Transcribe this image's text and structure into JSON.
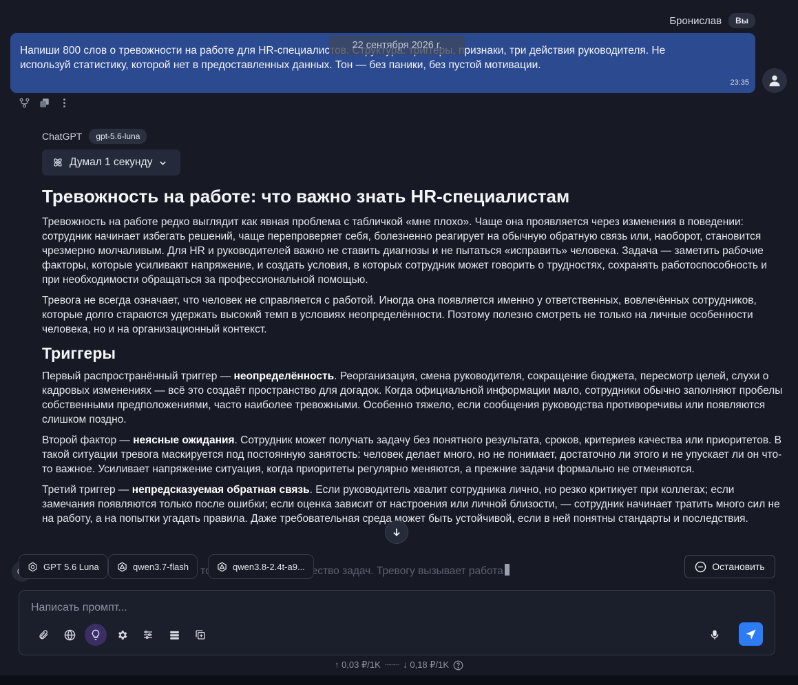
{
  "user": {
    "name": "Бронислав",
    "badge": "Вы",
    "message": "Напиши 800 слов о тревожности на работе для HR-специалистов. Структура: триггеры, признаки, три действия руководителя. Не используй статистику, которой нет в предоставленных данных. Тон — без паники, без пустой мотивации.",
    "time": "23:35"
  },
  "date_separator": "22 сентября 2026 г.",
  "message_actions": [
    "branch-icon",
    "copy-icon",
    "more-icon"
  ],
  "assistant": {
    "name": "ChatGPT",
    "model": "gpt-5.6-luna",
    "thinking_label": "Думал 1 секунду"
  },
  "answer": {
    "title": "Тревожность на работе: что важно знать HR-специалистам",
    "intro_1": "Тревожность на работе редко выглядит как явная проблема с табличкой «мне плохо». Чаще она проявляется через изменения в поведении: сотрудник начинает избегать решений, чаще перепроверяет себя, болезненно реагирует на обычную обратную связь или, наоборот, становится чрезмерно молчаливым. Для HR и руководителей важно не ставить диагнозы и не пытаться «исправить» человека. Задача — заметить рабочие факторы, которые усиливают напряжение, и создать условия, в которых сотрудник может говорить о трудностях, сохранять работоспособность и при необходимости обращаться за профессиональной помощью.",
    "intro_2": "Тревога не всегда означает, что человек не справляется с работой. Иногда она появляется именно у ответственных, вовлечённых сотрудников, которые долго стараются удержать высокий темп в условиях неопределённости. Поэтому полезно смотреть не только на личные особенности человека, но и на организационный контекст.",
    "section_triggers": "Триггеры",
    "t1_before": "Первый распространённый триггер — ",
    "t1_bold": "неопределённость",
    "t1_after": ". Реорганизация, смена руководителя, сокращение бюджета, пересмотр целей, слухи о кадровых изменениях — всё это создаёт пространство для догадок. Когда официальной информации мало, сотрудники обычно заполняют пробелы собственными предположениями, часто наиболее тревожными. Особенно тяжело, если сообщения руководства противоречивы или появляются слишком поздно.",
    "t2_before": "Второй фактор — ",
    "t2_bold": "неясные ожидания",
    "t2_after": ". Сотрудник может получать задачу без понятного результата, сроков, критериев качества или приоритетов. В такой ситуации тревога маскируется под постоянную занятость: человек делает много, но не понимает, достаточно ли этого и не упускает ли он что-то важное. Усиливает напряжение ситуация, когда приоритеты регулярно меняются, а прежние задачи формально не отменяются.",
    "t3_before": "Третий триггер — ",
    "t3_bold": "непредсказуемая обратная связь",
    "t3_after": ". Если руководитель хвалит сотрудника лично, но резко критикует при коллегах; если замечания появляются только после ошибки; если оценка зависит от настроения или личной близости, — сотрудник начинает тратить много сил не на работу, а на попытки угадать правила. Даже требовательная среда может быть устойчивой, если в ней понятны стандарты и последствия.",
    "streaming_text": "Четвёртый — не только большое количество задач. Тревогу вызывает работа"
  },
  "model_chips": [
    {
      "label": "GPT 5.6 Luna",
      "icon": "openai-icon"
    },
    {
      "label": "qwen3.7-flash",
      "icon": "qwen-icon"
    },
    {
      "label": "qwen3.8-2.4t-a9...",
      "icon": "qwen-icon"
    }
  ],
  "stop_label": "Остановить",
  "composer": {
    "placeholder": "Написать промпт...",
    "tools": [
      "paperclip-icon",
      "globe-icon",
      "lightbulb-icon",
      "gear-icon",
      "sliders-icon",
      "list-icon",
      "add-box-icon"
    ],
    "active_tool": "lightbulb-icon"
  },
  "pricing": {
    "input": "↑ 0,03 ₽/1K",
    "output": "↓ 0,18 ₽/1K"
  },
  "colors": {
    "background": "#171a24",
    "user_bubble": "#2c4a8f",
    "send_button": "#2d7cf6",
    "active_tool": "#3a2e63"
  }
}
